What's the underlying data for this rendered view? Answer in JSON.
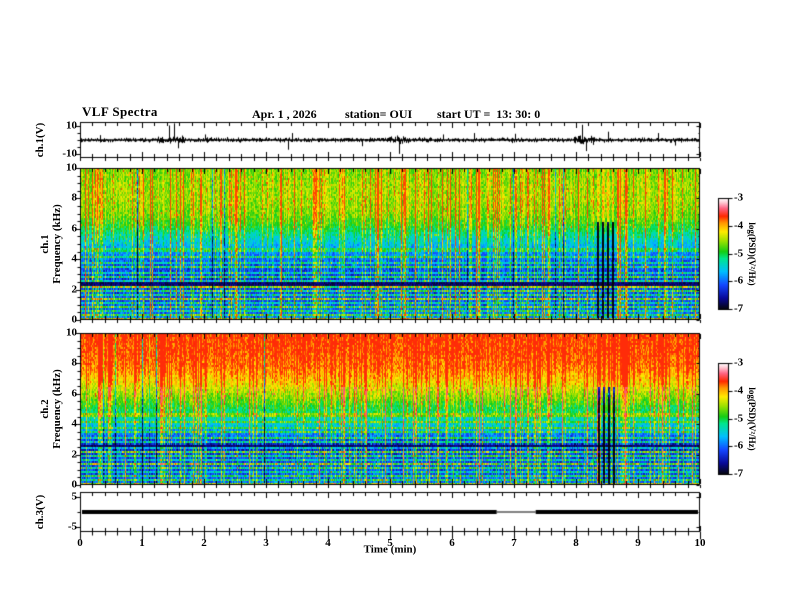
{
  "header": {
    "title": "VLF Spectra",
    "date": "Apr. 1 , 2026",
    "station": "station= OUI",
    "start_ut": "start UT =  13: 30: 0"
  },
  "time_axis": {
    "label": "Time (min)",
    "xlim": [
      0,
      10
    ],
    "ticks": [
      "0",
      "1",
      "2",
      "3",
      "4",
      "5",
      "6",
      "7",
      "8",
      "9",
      "10"
    ],
    "minor_per_major": 5
  },
  "colorbar": {
    "label": "log(PSD)(V²/Hz)",
    "ticks": [
      "-3",
      "-4",
      "-5",
      "-6",
      "-7"
    ],
    "vlim": [
      -7,
      -3
    ],
    "colormap": "black-blue-cyan-green-yellow-red-white"
  },
  "shared_seed": 42,
  "chart_data": [
    {
      "id": "ch1-waveform",
      "type": "line",
      "ylabel": "ch.1(V)",
      "ylim": [
        -13,
        13
      ],
      "yticks": [
        10,
        -10
      ],
      "xlim": [
        0,
        10
      ],
      "noise_amp_v": 1.3,
      "seed": 101,
      "burst_windows_min": [
        [
          1.25,
          1.7
        ],
        [
          4.95,
          5.3
        ],
        [
          7.95,
          8.3
        ]
      ],
      "spikes": [
        {
          "t": 0.32,
          "a": 3.5
        },
        {
          "t": 1.44,
          "a": 10.5
        },
        {
          "t": 1.52,
          "a": 12
        },
        {
          "t": 1.58,
          "a": -6
        },
        {
          "t": 2.02,
          "a": 4
        },
        {
          "t": 3.36,
          "a": -7
        },
        {
          "t": 3.42,
          "a": 5
        },
        {
          "t": 4.55,
          "a": -4.5
        },
        {
          "t": 5.15,
          "a": -10
        },
        {
          "t": 5.85,
          "a": 4
        },
        {
          "t": 6.35,
          "a": 5
        },
        {
          "t": 7.02,
          "a": 4.5
        },
        {
          "t": 8.1,
          "a": 11
        },
        {
          "t": 8.16,
          "a": -8
        },
        {
          "t": 8.52,
          "a": 6
        },
        {
          "t": 9.32,
          "a": 5
        },
        {
          "t": 9.6,
          "a": -4
        }
      ]
    },
    {
      "id": "ch1-spectrogram",
      "type": "heatmap",
      "ylabel_line1": "ch.1",
      "ylabel_line2": "Frequency (kHz)",
      "ylim": [
        0,
        10
      ],
      "yticks": [
        0,
        2,
        4,
        6,
        8,
        10
      ],
      "xlim": [
        0,
        10
      ],
      "value_range": [
        -7,
        -3
      ],
      "max_v": -3.7,
      "highf_clamp": null,
      "seed": 202,
      "profile": [
        [
          0,
          -5.85
        ],
        [
          0.4,
          -6.05
        ],
        [
          1.0,
          -6.2
        ],
        [
          1.8,
          -6.25
        ],
        [
          2.4,
          -6.45
        ],
        [
          3.0,
          -6.3
        ],
        [
          3.8,
          -6.15
        ],
        [
          4.6,
          -5.85
        ],
        [
          5.4,
          -5.45
        ],
        [
          6.2,
          -5.0
        ],
        [
          6.9,
          -4.72
        ],
        [
          8.0,
          -4.6
        ],
        [
          9.2,
          -4.65
        ],
        [
          10,
          -4.72
        ]
      ],
      "hlines": [
        {
          "f": 0.1,
          "b": 1.6
        },
        {
          "f": 0.35,
          "b": 1.1
        },
        {
          "f": 0.6,
          "b": 0.9
        },
        {
          "f": 0.85,
          "b": 1.2
        },
        {
          "f": 1.1,
          "b": 0.9
        },
        {
          "f": 1.35,
          "b": 1.7
        },
        {
          "f": 1.6,
          "b": 1.0
        },
        {
          "f": 1.9,
          "b": 1.3
        },
        {
          "f": 2.15,
          "b": 1.8
        },
        {
          "f": 2.5,
          "b": 1.0
        },
        {
          "f": 2.8,
          "b": 1.2
        },
        {
          "f": 3.1,
          "b": 0.9
        },
        {
          "f": 3.45,
          "b": 1.1
        },
        {
          "f": 3.8,
          "b": 0.8
        },
        {
          "f": 4.2,
          "b": 0.9
        },
        {
          "f": 4.6,
          "b": 0.7
        }
      ],
      "dark_bands": [
        [
          2.3,
          2.52
        ]
      ],
      "dark_streaks_min": [
        8.34,
        8.42,
        8.5,
        8.58
      ]
    },
    {
      "id": "ch2-spectrogram",
      "type": "heatmap",
      "ylabel_line1": "ch.2",
      "ylabel_line2": "Frequency (kHz)",
      "ylim": [
        0,
        10
      ],
      "yticks": [
        0,
        2,
        4,
        6,
        8,
        10
      ],
      "xlim": [
        0,
        10
      ],
      "value_range": [
        -7,
        -3
      ],
      "max_v": -3.4,
      "highf_clamp": {
        "f_above": 6.5,
        "max_v": -3.62
      },
      "seed": 303,
      "profile": [
        [
          0,
          -6.0
        ],
        [
          0.6,
          -6.2
        ],
        [
          1.2,
          -6.25
        ],
        [
          2.0,
          -6.3
        ],
        [
          2.55,
          -6.6
        ],
        [
          3.2,
          -6.1
        ],
        [
          3.8,
          -5.7
        ],
        [
          4.5,
          -5.35
        ],
        [
          5.2,
          -5.0
        ],
        [
          6.0,
          -4.6
        ],
        [
          6.8,
          -4.25
        ],
        [
          7.6,
          -3.95
        ],
        [
          8.6,
          -3.8
        ],
        [
          10,
          -3.72
        ]
      ],
      "hlines": [
        {
          "f": 0.1,
          "b": 1.5
        },
        {
          "f": 0.35,
          "b": 1.0
        },
        {
          "f": 0.6,
          "b": 1.1
        },
        {
          "f": 0.85,
          "b": 0.9
        },
        {
          "f": 1.1,
          "b": 1.2
        },
        {
          "f": 1.35,
          "b": 1.6
        },
        {
          "f": 1.6,
          "b": 0.9
        },
        {
          "f": 1.9,
          "b": 1.2
        },
        {
          "f": 2.15,
          "b": 1.6
        },
        {
          "f": 2.5,
          "b": 0.9
        },
        {
          "f": 2.8,
          "b": 1.1
        },
        {
          "f": 3.1,
          "b": 1.0
        },
        {
          "f": 3.45,
          "b": 0.9
        },
        {
          "f": 3.8,
          "b": 0.8
        },
        {
          "f": 4.2,
          "b": 0.7
        },
        {
          "f": 4.6,
          "b": 0.6
        }
      ],
      "dark_bands": [
        [
          2.45,
          2.68
        ]
      ],
      "dark_streaks_min": [
        8.36,
        8.44,
        8.52,
        8.6
      ]
    },
    {
      "id": "ch3-waveform",
      "type": "line",
      "ylabel": "ch.3(V)",
      "ylim": [
        -6.5,
        6.5
      ],
      "yticks": [
        5,
        -5
      ],
      "xlim": [
        0,
        10
      ],
      "band_center_v": 0,
      "band_halfwidth_v": 0.65,
      "gap_window_min": [
        6.72,
        7.35
      ],
      "gap_halfwidth_v": 0.15,
      "seed": 404
    }
  ]
}
